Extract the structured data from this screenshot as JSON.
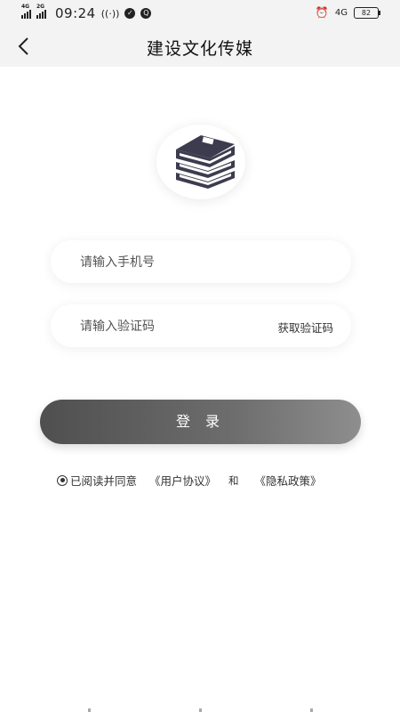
{
  "status_bar": {
    "network_left_1": "4G",
    "network_left_2": "2G",
    "time": "09:24",
    "network_right": "4G",
    "battery": "82"
  },
  "header": {
    "title": "建设文化传媒"
  },
  "form": {
    "phone_placeholder": "请输入手机号",
    "code_placeholder": "请输入验证码",
    "get_code_label": "获取验证码",
    "login_label": "登 录"
  },
  "agreement": {
    "prefix": "已阅读并同意",
    "user_agreement": "《用户协议》",
    "and": "和",
    "privacy_policy": "《隐私政策》"
  },
  "colors": {
    "accent": "#5a5a5a",
    "logo": "#3c3c4e"
  }
}
